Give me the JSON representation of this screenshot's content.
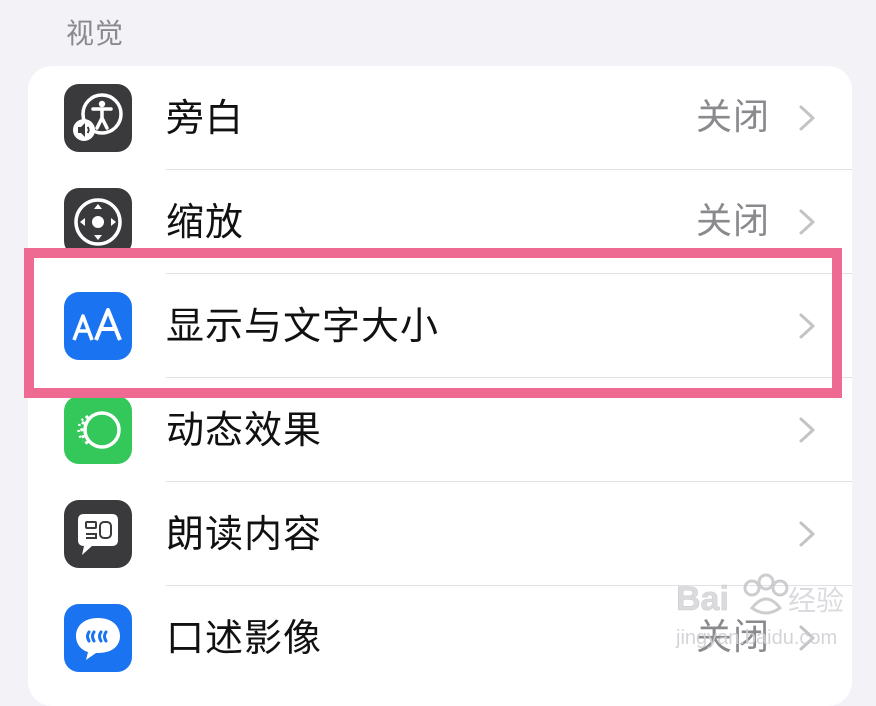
{
  "section": {
    "title": "视觉"
  },
  "rows": [
    {
      "label": "旁白",
      "value": "关闭",
      "icon": "voiceover-icon",
      "icon_bg": "#3a3a3c"
    },
    {
      "label": "缩放",
      "value": "关闭",
      "icon": "zoom-icon",
      "icon_bg": "#3a3a3c"
    },
    {
      "label": "显示与文字大小",
      "value": "",
      "icon": "text-size-icon",
      "icon_bg": "#1a73f0"
    },
    {
      "label": "动态效果",
      "value": "",
      "icon": "motion-icon",
      "icon_bg": "#34c759"
    },
    {
      "label": "朗读内容",
      "value": "",
      "icon": "spoken-content-icon",
      "icon_bg": "#3a3a3c"
    },
    {
      "label": "口述影像",
      "value": "关闭",
      "icon": "audio-descriptions-icon",
      "icon_bg": "#1a73f0"
    }
  ],
  "highlight_color": "#ee6a92",
  "watermark": {
    "text": "Baidu经验",
    "subtext": "jingyan.baidu.com"
  }
}
